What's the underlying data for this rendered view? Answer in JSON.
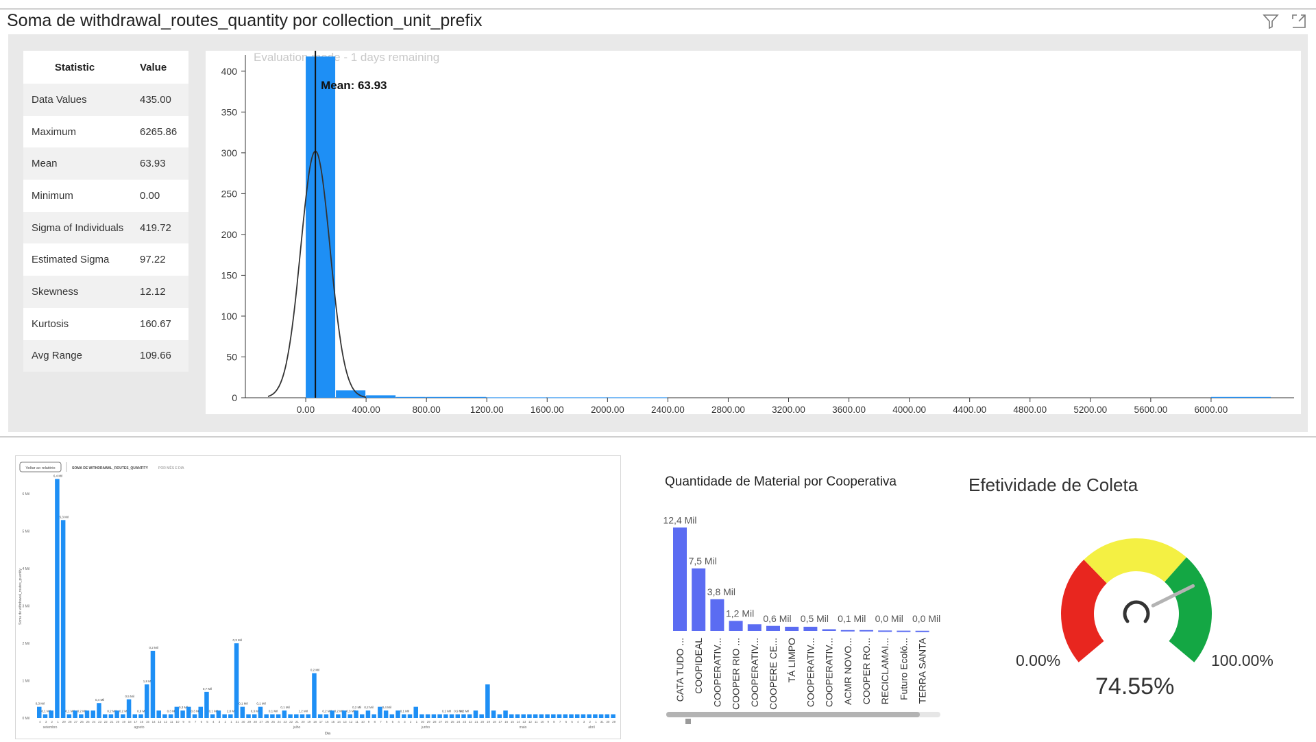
{
  "header": {
    "title": "Soma de withdrawal_routes_quantity por collection_unit_prefix",
    "filter_icon": "filter-icon",
    "focus_icon": "focus-mode-icon"
  },
  "stats_table": {
    "headers": [
      "Statistic",
      "Value"
    ],
    "rows": [
      {
        "label": "Data Values",
        "value": "435.00"
      },
      {
        "label": "Maximum",
        "value": "6265.86"
      },
      {
        "label": "Mean",
        "value": "63.93"
      },
      {
        "label": "Minimum",
        "value": "0.00"
      },
      {
        "label": "Sigma of Individuals",
        "value": "419.72"
      },
      {
        "label": "Estimated Sigma",
        "value": "97.22"
      },
      {
        "label": "Skewness",
        "value": "12.12"
      },
      {
        "label": "Kurtosis",
        "value": "160.67"
      },
      {
        "label": "Avg Range",
        "value": "109.66"
      }
    ]
  },
  "chart_data": [
    {
      "type": "bar",
      "name": "histogram",
      "watermark": "Evaluation mode - 1 days remaining",
      "mean_label": "Mean: 63.93",
      "mean": 63.93,
      "sigma": 97.22,
      "x_ticks": [
        "0.00",
        "400.00",
        "800.00",
        "1200.00",
        "1600.00",
        "2000.00",
        "2400.00",
        "2800.00",
        "3200.00",
        "3600.00",
        "4000.00",
        "4400.00",
        "4800.00",
        "5200.00",
        "5600.00",
        "6000.00"
      ],
      "y_ticks": [
        0,
        50,
        100,
        150,
        200,
        250,
        300,
        350,
        400
      ],
      "xlim": [
        -400,
        6550
      ],
      "ylim": [
        0,
        420
      ],
      "bins": [
        {
          "x0": 0,
          "x1": 200,
          "count": 418
        },
        {
          "x0": 200,
          "x1": 400,
          "count": 9
        },
        {
          "x0": 400,
          "x1": 600,
          "count": 3
        },
        {
          "x0": 600,
          "x1": 800,
          "count": 1
        },
        {
          "x0": 800,
          "x1": 1200,
          "count": 1
        },
        {
          "x0": 1200,
          "x1": 1600,
          "count": 0.5
        },
        {
          "x0": 1600,
          "x1": 2000,
          "count": 0.5
        },
        {
          "x0": 2000,
          "x1": 2400,
          "count": 0.5
        },
        {
          "x0": 6000,
          "x1": 6400,
          "count": 1
        }
      ],
      "curve_peak": 302
    },
    {
      "type": "bar",
      "name": "daily-mini",
      "header_button": "Voltar ao relatório",
      "header_title": "SOMA DE WITHDRAWAL_ROUTES_QUANTITY",
      "header_sub": "POR MÊS E DIA",
      "ylabel": "Soma de withdrawal_routes_quantity",
      "xlabel": "Dia",
      "y_ticks": [
        "0 Mil",
        "1 Mil",
        "2 Mil",
        "3 Mil",
        "4 Mil",
        "5 Mil",
        "6 Mil"
      ],
      "ylim": [
        0,
        6.5
      ],
      "month_labels": [
        "setembro",
        "agosto",
        "julho",
        "junho",
        "maio",
        "abril"
      ],
      "values": [
        0.3,
        0.1,
        0.2,
        6.4,
        5.3,
        0.1,
        0.2,
        0.1,
        0.2,
        0.2,
        0.4,
        0.1,
        0.1,
        0.2,
        0.1,
        0.5,
        0.1,
        0.1,
        0.9,
        1.8,
        0.2,
        0.1,
        0.1,
        0.3,
        0.2,
        0.3,
        0.1,
        0.3,
        0.7,
        0.1,
        0.2,
        0.1,
        0.1,
        2.0,
        0.3,
        0.1,
        0.1,
        0.3,
        0.1,
        0.1,
        0.1,
        0.2,
        0.1,
        0.1,
        0.1,
        0.1,
        1.2,
        0.1,
        0.1,
        0.2,
        0.1,
        0.2,
        0.1,
        0.2,
        0.1,
        0.2,
        0.1,
        0.3,
        0.2,
        0.1,
        0.2,
        0.1,
        0.1,
        0.3,
        0.1,
        0.1,
        0.1,
        0.1,
        0.1,
        0.1,
        0.1,
        0.1,
        0.1,
        0.2,
        0.1,
        0.9,
        0.2,
        0.1,
        0.2,
        0.1,
        0.1,
        0.1,
        0.1,
        0.1,
        0.1,
        0.1,
        0.1,
        0.1,
        0.1,
        0.1,
        0.1,
        0.1,
        0.1,
        0.1,
        0.1,
        0.1,
        0.1
      ],
      "labels": [
        "0,3 Mil",
        "0,1 Mil",
        "",
        "6,4 Mil",
        "5,3 Mil",
        "0,1 Mil",
        "",
        "0,2 Mil",
        "",
        "",
        "0,4 Mil",
        "",
        "0,2 Mil",
        "",
        "0,2 Mil",
        "0,5 Mil",
        "",
        "0,9 Mil",
        "1,8 Mil",
        "0,2 Mil",
        "",
        "",
        "0,3 Mil",
        "",
        "0,3 Mil",
        "",
        "0,3 Mil",
        "",
        "0,7 Mil",
        "0,1 Mil",
        "",
        "",
        "2,0 Mil",
        "0,3 Mil",
        "0,1 Mil",
        "",
        "0,3 Mil",
        "0,1 Mil",
        "",
        "0,1 Mil",
        "",
        "0,1 Mil",
        "",
        "",
        "1,2 Mil",
        "",
        "0,2 Mil",
        "",
        "0,2 Mil",
        "",
        "0,2 Mil",
        "",
        "0,3 Mil",
        "0,2 Mil",
        "",
        "0,2 Mil",
        "",
        "",
        "0,4 Mil",
        "",
        "",
        "0,1 Mil",
        "",
        "",
        "",
        "",
        "",
        "",
        "0,2 Mil",
        "",
        "0,9 Mil",
        "0,2 Mil",
        "",
        "",
        "",
        "",
        "",
        "",
        "",
        "",
        "",
        "",
        "",
        "",
        "",
        "",
        "",
        "",
        "",
        "",
        ""
      ],
      "x_tick_labels": [
        "4",
        "3",
        "2",
        "1",
        "29",
        "28",
        "27",
        "26",
        "25",
        "24",
        "23",
        "22",
        "21",
        "20",
        "19",
        "18",
        "17",
        "16",
        "15",
        "14",
        "13",
        "12",
        "11",
        "10",
        "9",
        "8",
        "7",
        "6",
        "5",
        "4",
        "3",
        "2",
        "1",
        "31",
        "30",
        "29",
        "28",
        "27",
        "26",
        "25",
        "24",
        "23",
        "22",
        "21",
        "20",
        "19",
        "18",
        "17",
        "16",
        "15",
        "14",
        "13",
        "12",
        "11",
        "10",
        "9",
        "8",
        "7",
        "6",
        "5",
        "4",
        "3",
        "2",
        "1",
        "30",
        "29",
        "28",
        "27",
        "26",
        "25",
        "24",
        "23",
        "22",
        "21",
        "20",
        "19",
        "18",
        "17",
        "16",
        "15",
        "14",
        "13",
        "12",
        "11",
        "10",
        "9",
        "8",
        "7",
        "6",
        "5",
        "4",
        "3",
        "2",
        "1",
        "31",
        "30",
        "29",
        "28"
      ]
    },
    {
      "type": "bar",
      "name": "cooperatives",
      "title": "Quantidade de Material por Cooperativa",
      "categories": [
        "CATA TUDO ...",
        "COOPIDEAL",
        "COOPERATIV...",
        "COOPER RIO ...",
        "COOPERATIV...",
        "COOPERE CE...",
        "TÁ LIMPO",
        "COOPERATIV...",
        "COOPERATIV...",
        "ACMR NOVO...",
        "COOPER RO...",
        "RECICLAMAI...",
        "Futuro Ecoló...",
        "TERRA SANTA"
      ],
      "values": [
        12.4,
        7.5,
        3.8,
        1.2,
        0.8,
        0.6,
        0.5,
        0.5,
        0.2,
        0.1,
        0.1,
        0.05,
        0.03,
        0.02
      ],
      "labels": [
        "12,4 Mil",
        "7,5 Mil",
        "3,8 Mil",
        "1,2 Mil",
        "",
        "0,6 Mil",
        "",
        "0,5 Mil",
        "",
        "0,1 Mil",
        "",
        "0,0 Mil",
        "",
        "0,0 Mil"
      ],
      "ylim": [
        0,
        13
      ],
      "bar_color": "#5b6cf2"
    },
    {
      "type": "gauge",
      "name": "efetividade",
      "title": "Efetividade de Coleta",
      "min_label": "0.00%",
      "max_label": "100.00%",
      "value_label": "74.55%",
      "value": 74.55,
      "colors": {
        "low": "#e8261f",
        "mid": "#f4f043",
        "high": "#14a744"
      }
    }
  ]
}
